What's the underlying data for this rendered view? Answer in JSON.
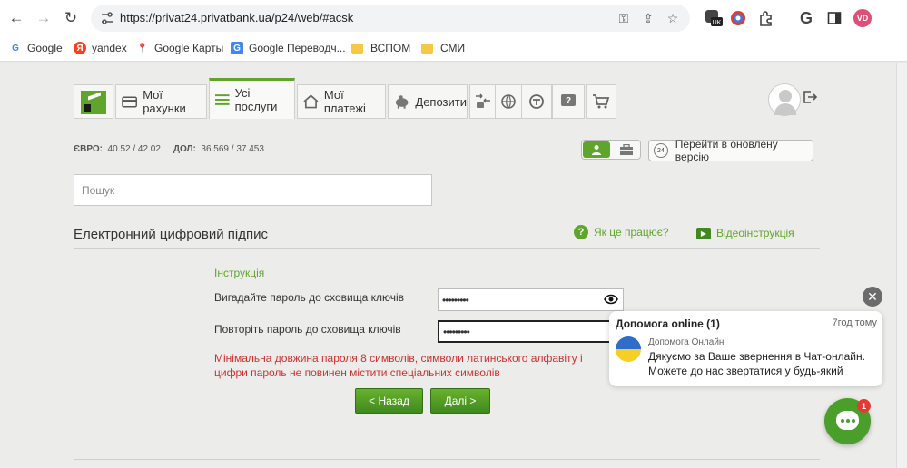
{
  "browser": {
    "url": "https://privat24.privatbank.ua/p24/web/#acsk",
    "profile_initials": "VD",
    "translate_badge": "UK"
  },
  "bookmarks": [
    {
      "label": "Google",
      "icon": "google-icon"
    },
    {
      "label": "yandex",
      "icon": "yandex-icon"
    },
    {
      "label": "Google Карты",
      "icon": "maps-pin-icon"
    },
    {
      "label": "Google Переводч...",
      "icon": "translate-icon"
    },
    {
      "label": "ВСПОМ",
      "icon": "folder-icon"
    },
    {
      "label": "СМИ",
      "icon": "folder-icon"
    }
  ],
  "nav": {
    "accounts": "Мої рахунки",
    "services": "Усі послуги",
    "payments": "Мої платежі",
    "deposits": "Депозити"
  },
  "rates": {
    "eur_label": "ЄВРО:",
    "eur_value": "40.52 / 42.02",
    "usd_label": "ДОЛ:",
    "usd_value": "36.569 / 37.453"
  },
  "new_version_label": "Перейти в оновлену версію",
  "new_version_badge": "24",
  "search": {
    "placeholder": "Пошук"
  },
  "section": {
    "title": "Електронний цифровий підпис",
    "help": "Як це працює?",
    "video": "Відеоінструкція"
  },
  "form": {
    "instruction_link": "Інструкція",
    "password_label": "Вигадайте пароль до сховища ключів",
    "password_value": "•••••••••",
    "repeat_label": "Повторіть пароль до сховища ключів",
    "repeat_value": "•••••••••",
    "error": "Мінімальна довжина пароля 8 символів, символи латинського алфавіту і цифри пароль не повинен містити спеціальних символів",
    "back": "< Назад",
    "next": "Далі >"
  },
  "chat": {
    "title": "Допомога online (1)",
    "time": "7год тому",
    "from": "Допомога Онлайн",
    "message": "Дякуємо за Ваше звернення в Чат-онлайн. Можете до нас звертатися у будь-який",
    "badge": "1"
  },
  "colors": {
    "accent": "#5fa52c",
    "error": "#d0302c"
  }
}
